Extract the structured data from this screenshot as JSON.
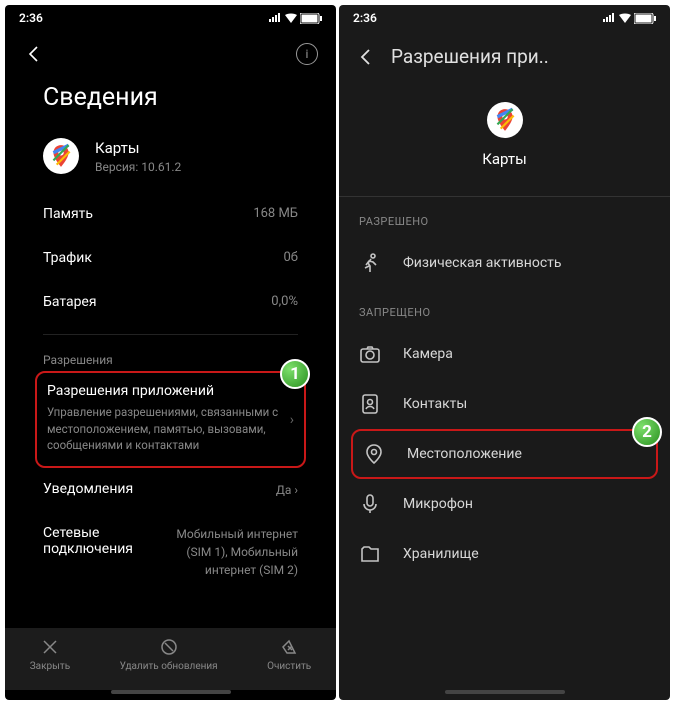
{
  "time": "2:36",
  "left": {
    "pageTitle": "Сведения",
    "appName": "Карты",
    "appVersion": "Версия: 10.61.2",
    "rows": {
      "memory": {
        "label": "Память",
        "value": "168 МБ"
      },
      "traffic": {
        "label": "Трафик",
        "value": "0б"
      },
      "battery": {
        "label": "Батарея",
        "value": "0,0%"
      }
    },
    "permSection": "Разрешения",
    "permTitle": "Разрешения приложений",
    "permDesc": "Управление разрешениями, связанными с местоположением, памятью, вызовами, сообщениями и контактами",
    "notif": {
      "label": "Уведомления",
      "value": "Да"
    },
    "net": {
      "label": "Сетевые подключения",
      "value": "Мобильный интернет (SIM 1), Мобильный интернет (SIM 2)"
    },
    "bottom": {
      "close": "Закрыть",
      "uninstall": "Удалить обновления",
      "clear": "Очистить"
    },
    "badge": "1"
  },
  "right": {
    "title": "Разрешения при..",
    "appName": "Карты",
    "allowed": "РАЗРЕШЕНО",
    "denied": "ЗАПРЕЩЕНО",
    "items": {
      "activity": "Физическая активность",
      "camera": "Камера",
      "contacts": "Контакты",
      "location": "Местоположение",
      "mic": "Микрофон",
      "storage": "Хранилище"
    },
    "badge": "2"
  }
}
